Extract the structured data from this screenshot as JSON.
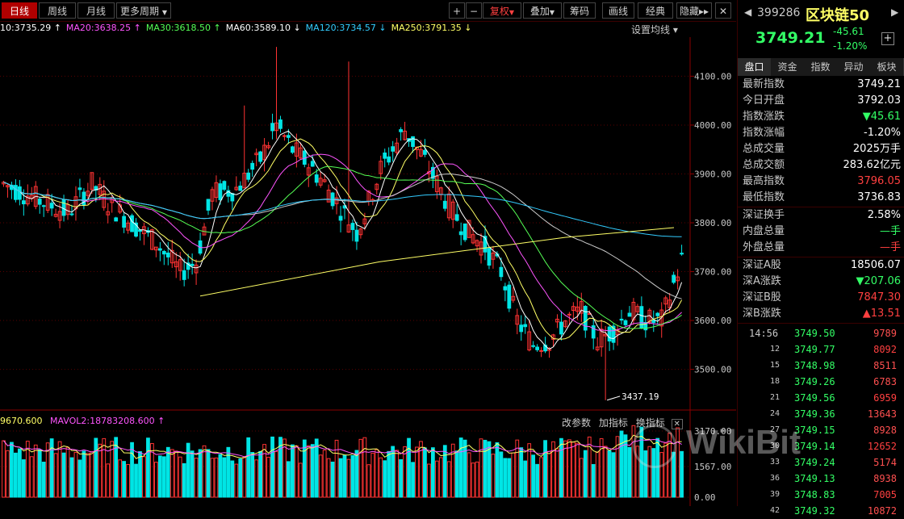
{
  "toolbar": {
    "tabs": [
      "日线",
      "周线",
      "月线",
      "更多周期"
    ],
    "buttons": [
      "+",
      "−",
      "复权",
      "叠加",
      "筹码",
      "画线",
      "经典",
      "隐藏"
    ]
  },
  "ma_line": [
    {
      "label": "10:3735.29",
      "color": "#ffffff"
    },
    {
      "label": "MA20:3638.25",
      "color": "#ff55ff"
    },
    {
      "label": "MA30:3618.50",
      "color": "#55ff55"
    },
    {
      "label": "MA60:3589.10",
      "color": "#ffffff"
    },
    {
      "label": "MA120:3734.57",
      "color": "#33ccff"
    },
    {
      "label": "MA250:3791.35",
      "color": "#ffff66"
    }
  ],
  "ma_settings": "设置均线",
  "y_axis": [
    "4100.00",
    "4000.00",
    "3900.00",
    "3800.00",
    "3700.00",
    "3600.00",
    "3500.00"
  ],
  "annotation_low": "3437.19",
  "vol_line": {
    "vol1": "9670.600",
    "vol2": "MAVOL2:18783208.600"
  },
  "vol_tools": [
    "改参数",
    "加指标",
    "换指标"
  ],
  "vol_axis": [
    "3170.00",
    "1567.00",
    "0.00"
  ],
  "panel": {
    "code": "399286",
    "name": "区块链50",
    "price": "3749.21",
    "change": "-45.61",
    "change_pct": "-1.20%",
    "tabs": [
      "盘口",
      "资金",
      "指数",
      "异动",
      "板块"
    ],
    "rows": [
      {
        "k": "最新指数",
        "v": "3749.21",
        "c": "#ffffff"
      },
      {
        "k": "今日开盘",
        "v": "3792.03",
        "c": "#ffffff"
      },
      {
        "k": "指数涨跌",
        "v": "▼45.61",
        "c": "#33ff66"
      },
      {
        "k": "指数涨幅",
        "v": "-1.20%",
        "c": "#ffffff"
      },
      {
        "k": "总成交量",
        "v": "2025万手",
        "c": "#ffffff"
      },
      {
        "k": "总成交额",
        "v": "283.62亿元",
        "c": "#ffffff"
      },
      {
        "k": "最高指数",
        "v": "3796.05",
        "c": "#ff4040"
      },
      {
        "k": "最低指数",
        "v": "3736.83",
        "c": "#ffffff"
      }
    ],
    "rows2": [
      {
        "k": "深证换手",
        "v": "2.58%",
        "c": "#ffffff"
      },
      {
        "k": "内盘总量",
        "v": "—手",
        "c": "#33ff66"
      },
      {
        "k": "外盘总量",
        "v": "—手",
        "c": "#ff4040"
      }
    ],
    "rows3": [
      {
        "k": "深证A股",
        "v": "18506.07",
        "c": "#ffffff"
      },
      {
        "k": "深A涨跌",
        "v": "▼207.06",
        "c": "#33ff66"
      },
      {
        "k": "深证B股",
        "v": "7847.30",
        "c": "#ff4040"
      },
      {
        "k": "深B涨跌",
        "v": "▲13.51",
        "c": "#ff4040"
      }
    ],
    "ticks": [
      {
        "t": "14:56",
        "p": "3749.50",
        "q": "9789"
      },
      {
        "t": "12",
        "p": "3749.77",
        "q": "8092"
      },
      {
        "t": "15",
        "p": "3748.98",
        "q": "8511"
      },
      {
        "t": "18",
        "p": "3749.26",
        "q": "6783"
      },
      {
        "t": "21",
        "p": "3749.56",
        "q": "6959"
      },
      {
        "t": "24",
        "p": "3749.36",
        "q": "13643"
      },
      {
        "t": "27",
        "p": "3749.15",
        "q": "8928"
      },
      {
        "t": "30",
        "p": "3749.14",
        "q": "12652"
      },
      {
        "t": "33",
        "p": "3749.24",
        "q": "5174"
      },
      {
        "t": "36",
        "p": "3749.13",
        "q": "8938"
      },
      {
        "t": "39",
        "p": "3748.83",
        "q": "7005"
      },
      {
        "t": "42",
        "p": "3749.32",
        "q": "10872"
      }
    ]
  },
  "watermark": "WikiBit",
  "colors": {
    "up": "#ff3333",
    "down": "#00e5e5",
    "grid": "#5a0000"
  }
}
